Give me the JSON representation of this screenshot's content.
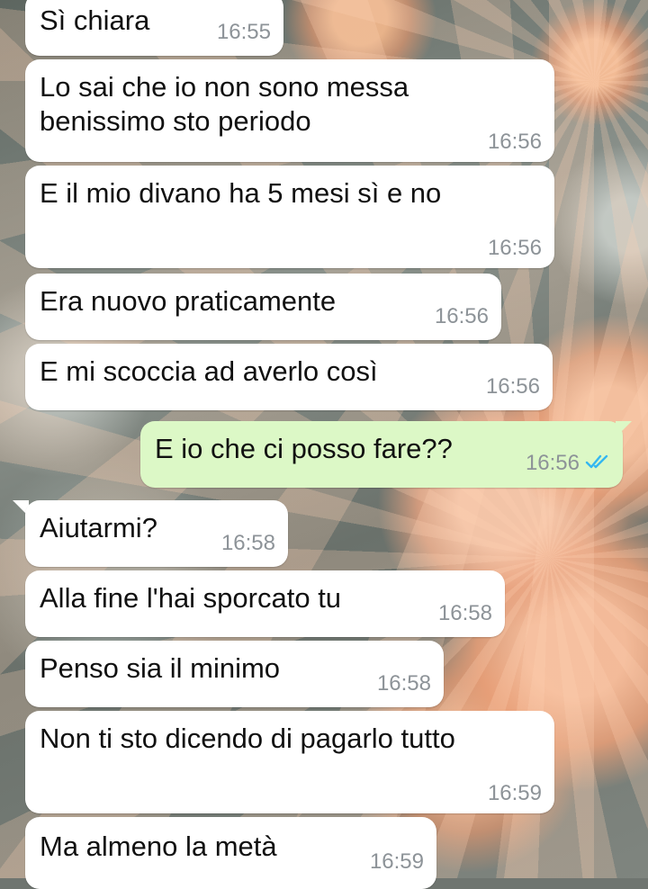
{
  "messages": [
    {
      "text": "Sì chiara",
      "time": "16:55",
      "direction": "in"
    },
    {
      "text": "Lo sai che io non sono messa benissimo sto periodo",
      "line1": "Lo sai che io non sono messa",
      "line2": "benissimo sto periodo",
      "time": "16:56",
      "direction": "in"
    },
    {
      "text": "E il mio divano ha 5 mesi sì e no",
      "time": "16:56",
      "direction": "in"
    },
    {
      "text": "Era nuovo praticamente",
      "time": "16:56",
      "direction": "in"
    },
    {
      "text": "E mi scoccia ad averlo così",
      "time": "16:56",
      "direction": "in"
    },
    {
      "text": "E io che ci posso fare??",
      "time": "16:56",
      "direction": "out",
      "status": "read"
    },
    {
      "text": "Aiutarmi?",
      "time": "16:58",
      "direction": "in"
    },
    {
      "text": "Alla fine l'hai sporcato tu",
      "time": "16:58",
      "direction": "in"
    },
    {
      "text": "Penso sia il minimo",
      "time": "16:58",
      "direction": "in"
    },
    {
      "text": "Non ti sto dicendo di pagarlo tutto",
      "time": "16:59",
      "direction": "in"
    },
    {
      "text": "Ma almeno la metà",
      "time": "16:59",
      "direction": "in"
    }
  ],
  "colors": {
    "incoming_bubble": "#ffffff",
    "outgoing_bubble": "#dcf8c6",
    "timestamp": "#8d9398",
    "read_ticks": "#34b7f1"
  },
  "icons": {
    "read_receipt": "double-check-icon"
  }
}
